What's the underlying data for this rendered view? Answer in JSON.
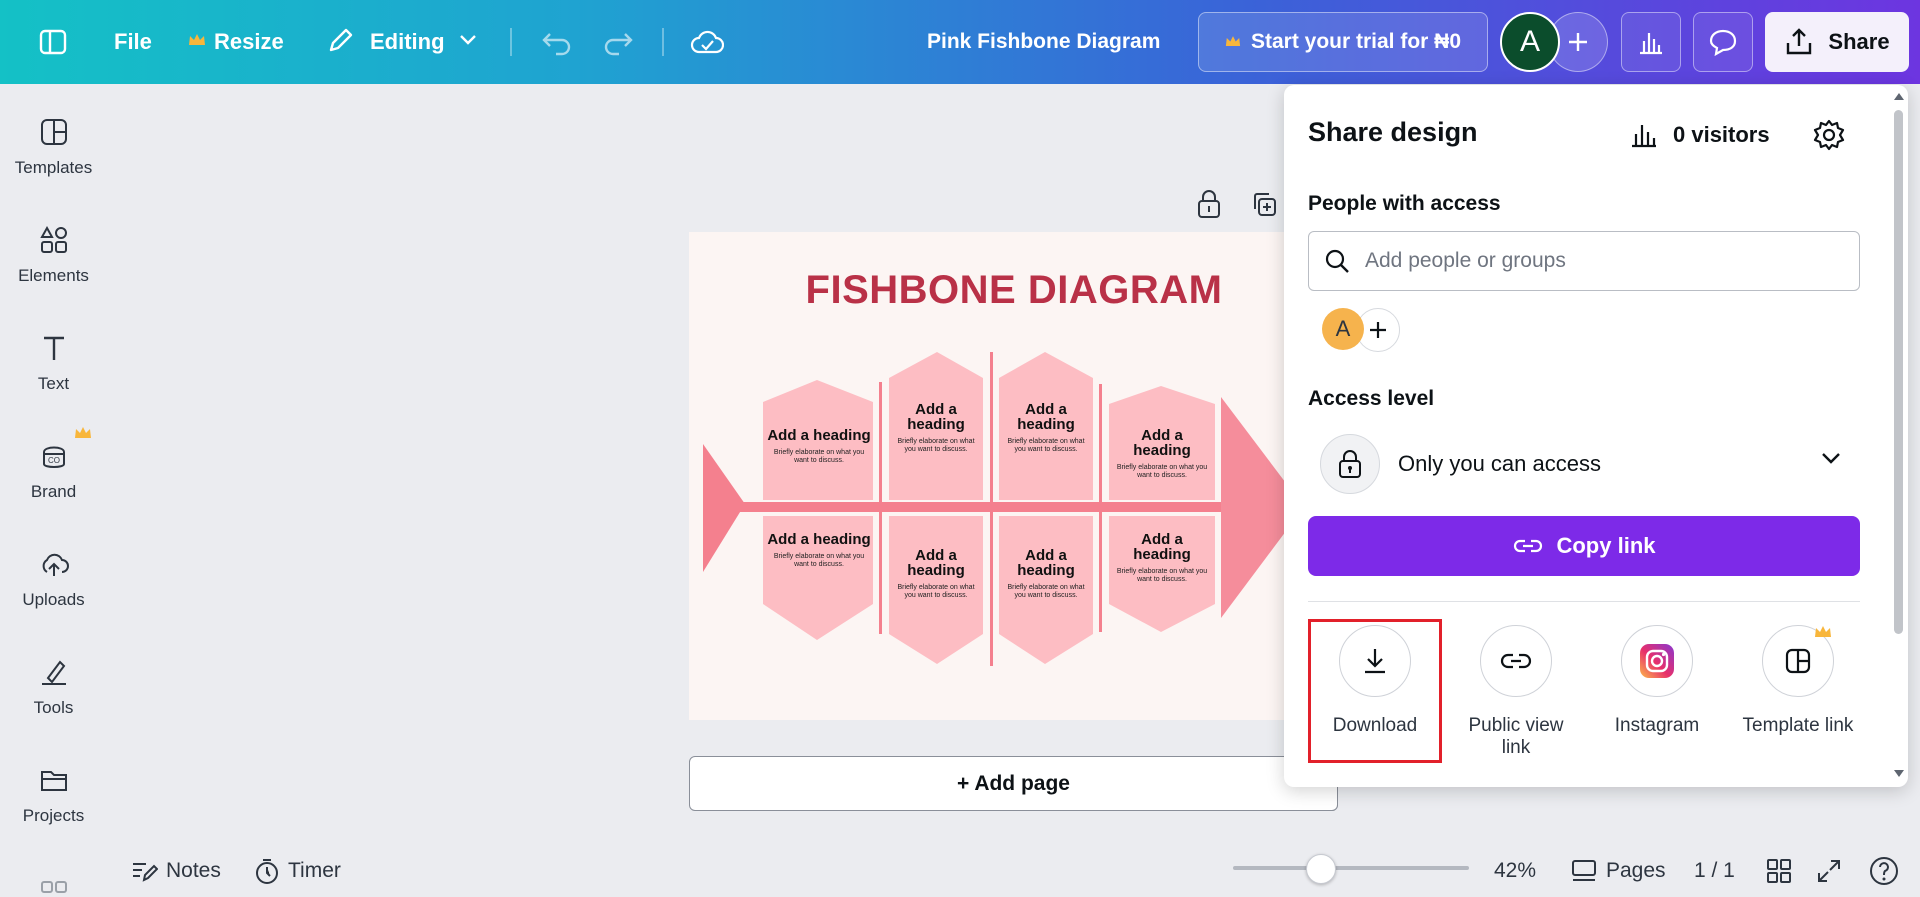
{
  "topbar": {
    "file_label": "File",
    "resize_label": "Resize",
    "editing_label": "Editing",
    "doc_title": "Pink Fishbone Diagram",
    "trial_label": "Start your trial for ₦0",
    "avatar_initial": "A",
    "share_label": "Share"
  },
  "sidebar": {
    "items": [
      {
        "label": "Templates",
        "icon": "templates-icon"
      },
      {
        "label": "Elements",
        "icon": "elements-icon"
      },
      {
        "label": "Text",
        "icon": "text-icon"
      },
      {
        "label": "Brand",
        "icon": "brand-icon"
      },
      {
        "label": "Uploads",
        "icon": "uploads-icon"
      },
      {
        "label": "Tools",
        "icon": "tools-icon"
      },
      {
        "label": "Projects",
        "icon": "projects-icon"
      }
    ]
  },
  "design": {
    "title": "FISHBONE DIAGRAM",
    "boxes": [
      {
        "heading": "Add a heading",
        "body": "Briefly elaborate on what you want to discuss."
      },
      {
        "heading": "Add a heading",
        "body": "Briefly elaborate on what you want to discuss."
      },
      {
        "heading": "Add a heading",
        "body": "Briefly elaborate on what you want to discuss."
      },
      {
        "heading": "Add a heading",
        "body": "Briefly elaborate on what you want to discuss."
      },
      {
        "heading": "Add a heading",
        "body": "Briefly elaborate on what you want to discuss."
      },
      {
        "heading": "Add a heading",
        "body": "Briefly elaborate on what you want to discuss."
      },
      {
        "heading": "Add a heading",
        "body": "Briefly elaborate on what you want to discuss."
      },
      {
        "heading": "Add a heading",
        "body": "Briefly elaborate on what you want to discuss."
      }
    ],
    "colors": {
      "title": "#b93147",
      "box": "#fdbdc3",
      "bone": "#f4808e"
    }
  },
  "canvas": {
    "add_page_label": "+ Add page"
  },
  "bottombar": {
    "notes_label": "Notes",
    "timer_label": "Timer",
    "zoom": "42%",
    "zoom_level": 0.42,
    "pages_label": "Pages",
    "page_count": "1 / 1"
  },
  "share_panel": {
    "title": "Share design",
    "visitors": "0 visitors",
    "people_heading": "People with access",
    "search_placeholder": "Add people or groups",
    "member_initial": "A",
    "access_heading": "Access level",
    "access_value": "Only you can access",
    "copy_link_label": "Copy link",
    "options": [
      {
        "label": "Download",
        "icon": "download-icon"
      },
      {
        "label": "Public view link",
        "icon": "link-icon"
      },
      {
        "label": "Instagram",
        "icon": "instagram-icon"
      },
      {
        "label": "Template link",
        "icon": "template-link-icon"
      }
    ],
    "accent": "#7d2ae8",
    "highlight": "#e2202a"
  }
}
